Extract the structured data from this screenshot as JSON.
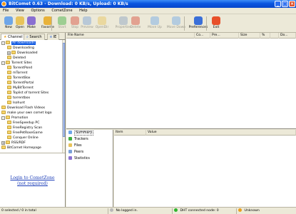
{
  "window": {
    "title": "BitComet 0.63 - Download: 0 KB/s, Upload: 0 KB/s"
  },
  "menu": [
    "File",
    "View",
    "Options",
    "CometZone",
    "Help"
  ],
  "toolbar": {
    "buttons": [
      {
        "label": "New",
        "icon": "new-icon",
        "color": "#6ea6e8",
        "disabled": false
      },
      {
        "label": "Open",
        "icon": "open-icon",
        "color": "#e8c35a",
        "disabled": false
      },
      {
        "label": "Make",
        "icon": "make-icon",
        "color": "#8a6fd1",
        "disabled": false
      },
      {
        "label": "Favorite",
        "icon": "favorite-icon",
        "color": "#e8b23a",
        "disabled": false
      },
      {
        "label": "Start",
        "icon": "start-icon",
        "color": "#3fae3f",
        "disabled": true
      },
      {
        "label": "Stop",
        "icon": "stop-icon",
        "color": "#d84a3a",
        "disabled": true
      },
      {
        "label": "Preview",
        "icon": "preview-icon",
        "color": "#7aa0d8",
        "disabled": true
      },
      {
        "label": "OpenDir",
        "icon": "opendir-icon",
        "color": "#e8c35a",
        "disabled": true
      },
      {
        "label": "Properties",
        "icon": "properties-icon",
        "color": "#8aa0c0",
        "disabled": true
      },
      {
        "label": "Delete",
        "icon": "delete-icon",
        "color": "#d84a3a",
        "disabled": true
      },
      {
        "label": "Move Up",
        "icon": "move-up-icon",
        "color": "#6ea6e8",
        "disabled": true
      },
      {
        "label": "Move Down",
        "icon": "move-down-icon",
        "color": "#6ea6e8",
        "disabled": true
      },
      {
        "label": "Preferences",
        "icon": "preferences-icon",
        "color": "#3a6fd8",
        "disabled": false
      },
      {
        "label": "Exit",
        "icon": "exit-icon",
        "color": "#e8502a",
        "disabled": false
      }
    ]
  },
  "left_panel": {
    "tabs": [
      "Channel",
      "Search",
      "IE"
    ],
    "tree": [
      {
        "label": "All downloads",
        "level": 0,
        "box": "-",
        "selected": true
      },
      {
        "label": "Downloading",
        "level": 1,
        "box": "",
        "selected": false
      },
      {
        "label": "Downloaded",
        "level": 1,
        "box": "+",
        "selected": false
      },
      {
        "label": "Deleted",
        "level": 1,
        "box": "",
        "selected": false
      },
      {
        "label": "Torrent Sites",
        "level": 0,
        "box": "-",
        "selected": false
      },
      {
        "label": "TorrentPond",
        "level": 1,
        "box": "",
        "selected": false
      },
      {
        "label": "mTorrent",
        "level": 1,
        "box": "",
        "selected": false
      },
      {
        "label": "TorrentBox",
        "level": 1,
        "box": "",
        "selected": false
      },
      {
        "label": "TorrentPortal",
        "level": 1,
        "box": "",
        "selected": false
      },
      {
        "label": "MyBitTorrent",
        "level": 1,
        "box": "",
        "selected": false
      },
      {
        "label": "Toplist of torrent Sites",
        "level": 1,
        "box": "",
        "selected": false
      },
      {
        "label": "torrentbox",
        "level": 1,
        "box": "",
        "selected": false
      },
      {
        "label": "Isohunt",
        "level": 1,
        "box": "",
        "selected": false
      },
      {
        "label": "Download Flash Videos",
        "level": 0,
        "box": "",
        "selected": false
      },
      {
        "label": "make your own comet logo",
        "level": 0,
        "box": "",
        "selected": false
      },
      {
        "label": "Promotion",
        "level": 0,
        "box": "-",
        "selected": false
      },
      {
        "label": "FreeSpeedup PC",
        "level": 1,
        "box": "",
        "selected": false
      },
      {
        "label": "FreeRegistry Scan",
        "level": 1,
        "box": "",
        "selected": false
      },
      {
        "label": "FreePetRoseGame",
        "level": 1,
        "box": "",
        "selected": false
      },
      {
        "label": "Conquer Online",
        "level": 1,
        "box": "",
        "selected": false
      },
      {
        "label": "RSS/RDF",
        "level": 0,
        "box": "+",
        "selected": false
      },
      {
        "label": "BitComet Homepage",
        "level": 0,
        "box": "",
        "selected": false
      }
    ],
    "login_link": "Login to CometZone",
    "login_sub": "(not required)"
  },
  "file_list": {
    "columns": [
      "File Name",
      "Co...",
      "Pre...",
      "Size",
      "%",
      "",
      "Do..."
    ]
  },
  "detail_tabs": [
    {
      "label": "Summary",
      "icon": "summary-icon",
      "color": "#6ea6e8",
      "active": true
    },
    {
      "label": "Trackers",
      "icon": "trackers-icon",
      "color": "#3fae3f",
      "active": false
    },
    {
      "label": "Files",
      "icon": "files-icon",
      "color": "#e8c35a",
      "active": false
    },
    {
      "label": "Peers",
      "icon": "peers-icon",
      "color": "#7aa0d8",
      "active": false
    },
    {
      "label": "Statistics",
      "icon": "statistics-icon",
      "color": "#8a6fd1",
      "active": false
    }
  ],
  "details": {
    "columns": [
      "Item",
      "Value"
    ]
  },
  "status": {
    "selection": "0 selected / 0 in total",
    "login": "No logged in.",
    "dht": "DHT connected node: 0",
    "port": "Unknown",
    "colors": {
      "login": "#b8b8b8",
      "dht": "#2fb52f",
      "port": "#e9a020"
    }
  }
}
